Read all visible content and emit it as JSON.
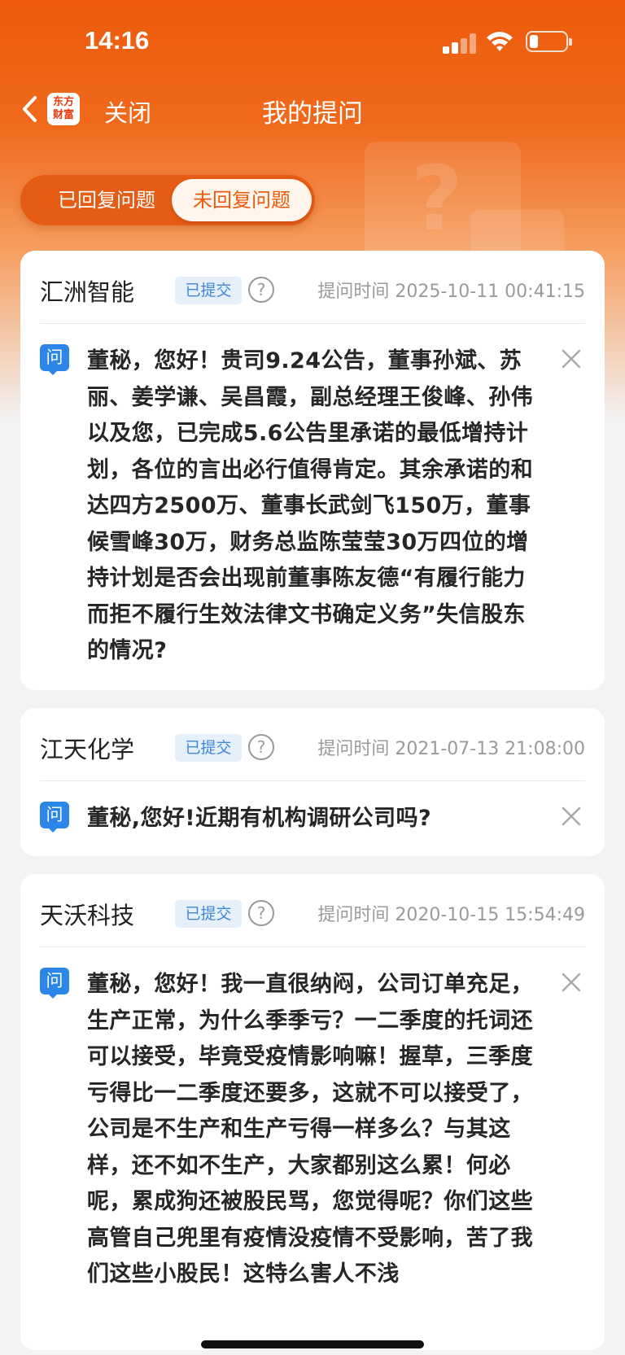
{
  "status_bar": {
    "time": "14:16"
  },
  "nav": {
    "logo_text_line1": "东方",
    "logo_text_line2": "财富",
    "close_label": "关闭",
    "title": "我的提问"
  },
  "tabs": [
    {
      "label": "已回复问题",
      "active": false
    },
    {
      "label": "未回复问题",
      "active": true
    }
  ],
  "questions": [
    {
      "company": "汇洲智能",
      "status": "已提交",
      "time": "提问时间 2025-10-11 00:41:15",
      "question_icon": "问",
      "text": "董秘，您好！贵司9.24公告，董事孙斌、苏丽、姜学谦、吴昌霞，副总经理王俊峰、孙伟以及您，已完成5.6公告里承诺的最低增持计划，各位的言出必行值得肯定。其余承诺的和达四方2500万、董事长武剑飞150万，董事候雪峰30万，财务总监陈莹莹30万四位的增持计划是否会出现前董事陈友德“有履行能力而拒不履行生效法律文书确定义务”失信股东的情况?"
    },
    {
      "company": "江天化学",
      "status": "已提交",
      "time": "提问时间 2021-07-13 21:08:00",
      "question_icon": "问",
      "text": "董秘,您好!近期有机构调研公司吗?"
    },
    {
      "company": "天沃科技",
      "status": "已提交",
      "time": "提问时间 2020-10-15 15:54:49",
      "question_icon": "问",
      "text": "董秘，您好！我一直很纳闷，公司订单充足，生产正常，为什么季季亏？一二季度的托词还可以接受，毕竟受疫情影响嘛！握草，三季度亏得比一二季度还要多，这就不可以接受了，公司是不生产和生产亏得一样多么？与其这样，还不如不生产，大家都别这么累！何必呢，累成狗还被股民骂，您觉得呢？你们这些高管自己兜里有疫情没疫情不受影响，苦了我们这些小股民！这特么害人不浅"
    }
  ],
  "colors": {
    "brand_orange": "#ed5a0c",
    "badge_blue": "#3f86d8",
    "question_icon_blue": "#2b86e8"
  },
  "icons": [
    "back-chevron-icon",
    "eastmoney-logo",
    "help-icon",
    "question-icon",
    "close-icon",
    "signal-icon",
    "wifi-icon",
    "battery-icon"
  ]
}
